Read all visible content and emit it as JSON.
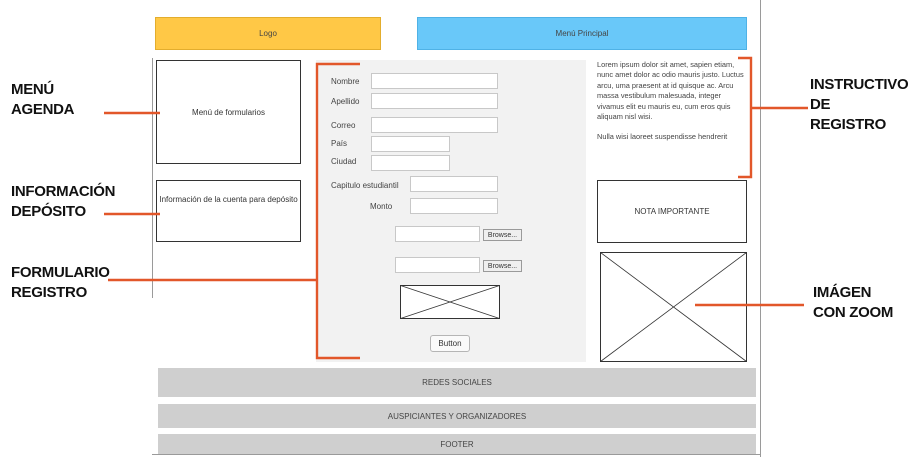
{
  "header": {
    "logo_label": "Logo",
    "menu_label": "Menú Principal"
  },
  "left": {
    "forms_menu_label": "Menú de formularios",
    "deposit_info_label": "Información de la cuenta para depósito"
  },
  "form": {
    "fields": {
      "name": "Nombre",
      "surname": "Apellido",
      "email": "Correo",
      "country": "País",
      "city": "Ciudad",
      "chapter": "Capitulo estudiantil",
      "amount": "Monto"
    },
    "browse_label": "Browse...",
    "button_label": "Button"
  },
  "right": {
    "instructions_p1": "Lorem ipsum dolor sit amet, sapien etiam, nunc amet dolor ac odio mauris justo. Luctus arcu, uma praesent at id quisque ac. Arcu massa vestibulum malesuada, integer vivamus elit eu mauris eu, cum eros quis aliquam nisl wisi.",
    "instructions_p2": "Nulla wisi laoreet suspendisse hendrerit",
    "important_note": "NOTA IMPORTANTE"
  },
  "footer_bars": {
    "social": "REDES SOCIALES",
    "sponsors": "AUSPICIANTES Y ORGANIZADORES",
    "footer": "FOOTER"
  },
  "annotations": {
    "menu_agenda": [
      "MENÚ",
      "AGENDA"
    ],
    "deposit_info": [
      "INFORMACIÓN",
      "DEPÓSITO"
    ],
    "form_register": [
      "FORMULARIO",
      "REGISTRO"
    ],
    "instructions": [
      "INSTRUCTIVO",
      "DE",
      "REGISTRO"
    ],
    "zoom_image": [
      "IMÁGEN",
      "CON ZOOM"
    ]
  },
  "colors": {
    "logo": "#ffc846",
    "menu": "#69c8f9",
    "annotation_line": "#e2572a",
    "bar_gray": "#cfcfcf"
  }
}
